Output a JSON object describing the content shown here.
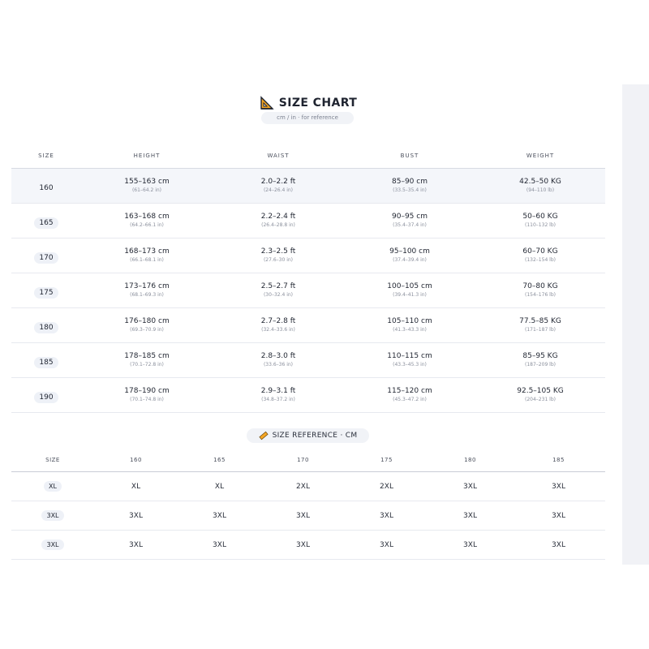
{
  "title": "SIZE CHART",
  "subtitle": "cm / in · for reference",
  "size_table": {
    "headers": [
      "SIZE",
      "HEIGHT",
      "WAIST",
      "BUST",
      "WEIGHT"
    ],
    "rows": [
      {
        "size": "160",
        "height": "155–163 cm",
        "height_sub": "(61–64.2 in)",
        "waist": "2.0–2.2 ft",
        "waist_sub": "(24–26.4 in)",
        "bust": "85–90 cm",
        "bust_sub": "(33.5–35.4 in)",
        "weight": "42.5–50 KG",
        "weight_sub": "(94–110 lb)"
      },
      {
        "size": "165",
        "height": "163–168 cm",
        "height_sub": "(64.2–66.1 in)",
        "waist": "2.2–2.4 ft",
        "waist_sub": "(26.4–28.8 in)",
        "bust": "90–95 cm",
        "bust_sub": "(35.4–37.4 in)",
        "weight": "50–60 KG",
        "weight_sub": "(110–132 lb)"
      },
      {
        "size": "170",
        "height": "168–173 cm",
        "height_sub": "(66.1–68.1 in)",
        "waist": "2.3–2.5 ft",
        "waist_sub": "(27.6–30 in)",
        "bust": "95–100 cm",
        "bust_sub": "(37.4–39.4 in)",
        "weight": "60–70 KG",
        "weight_sub": "(132–154 lb)"
      },
      {
        "size": "175",
        "height": "173–176 cm",
        "height_sub": "(68.1–69.3 in)",
        "waist": "2.5–2.7 ft",
        "waist_sub": "(30–32.4 in)",
        "bust": "100–105 cm",
        "bust_sub": "(39.4–41.3 in)",
        "weight": "70–80 KG",
        "weight_sub": "(154–176 lb)"
      },
      {
        "size": "180",
        "height": "176–180 cm",
        "height_sub": "(69.3–70.9 in)",
        "waist": "2.7–2.8 ft",
        "waist_sub": "(32.4–33.6 in)",
        "bust": "105–110 cm",
        "bust_sub": "(41.3–43.3 in)",
        "weight": "77.5–85 KG",
        "weight_sub": "(171–187 lb)"
      },
      {
        "size": "185",
        "height": "178–185 cm",
        "height_sub": "(70.1–72.8 in)",
        "waist": "2.8–3.0 ft",
        "waist_sub": "(33.6–36 in)",
        "bust": "110–115 cm",
        "bust_sub": "(43.3–45.3 in)",
        "weight": "85–95 KG",
        "weight_sub": "(187–209 lb)"
      },
      {
        "size": "190",
        "height": "178–190 cm",
        "height_sub": "(70.1–74.8 in)",
        "waist": "2.9–3.1 ft",
        "waist_sub": "(34.8–37.2 in)",
        "bust": "115–120 cm",
        "bust_sub": "(45.3–47.2 in)",
        "weight": "92.5–105 KG",
        "weight_sub": "(204–231 lb)"
      }
    ]
  },
  "reference": {
    "label": "SIZE REFERENCE · CM",
    "headers": [
      "SIZE",
      "160",
      "165",
      "170",
      "175",
      "180",
      "185"
    ],
    "rows": [
      {
        "size": "XL",
        "cells": [
          "XL",
          "XL",
          "2XL",
          "2XL",
          "3XL",
          "3XL"
        ]
      },
      {
        "size": "3XL",
        "cells": [
          "3XL",
          "3XL",
          "3XL",
          "3XL",
          "3XL",
          "3XL"
        ]
      },
      {
        "size": "3XL",
        "cells": [
          "3XL",
          "3XL",
          "3XL",
          "3XL",
          "3XL",
          "3XL"
        ]
      }
    ]
  },
  "colors": {
    "accent": "#f5a623",
    "text": "#1f2430",
    "header_row": "#f4f6fa",
    "pill": "#f1f3f7"
  },
  "icons": {
    "title": "set-square-ruler-icon",
    "reference": "ruler-icon"
  }
}
